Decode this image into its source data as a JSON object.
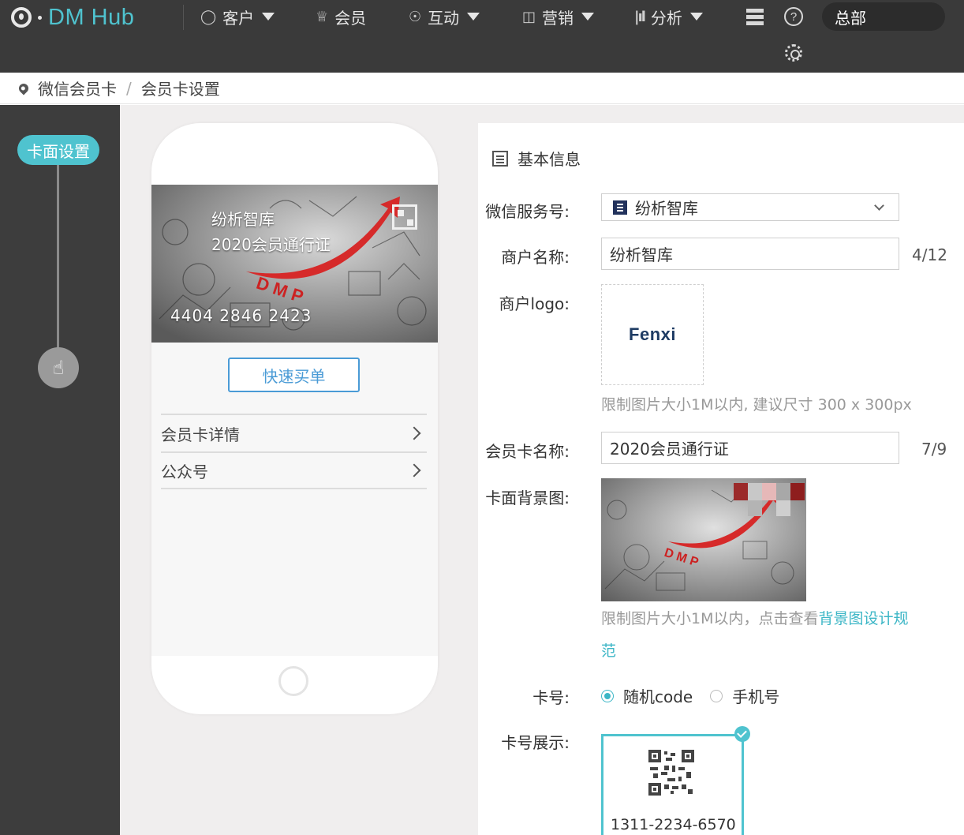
{
  "app": {
    "logo_text": "DM Hub"
  },
  "nav": {
    "items": [
      {
        "label": "客户",
        "icon": "user-icon",
        "has_caret": true
      },
      {
        "label": "会员",
        "icon": "crown-icon",
        "has_caret": false
      },
      {
        "label": "互动",
        "icon": "interaction-icon",
        "has_caret": true
      },
      {
        "label": "营销",
        "icon": "gift-icon",
        "has_caret": true
      },
      {
        "label": "分析",
        "icon": "bar-chart-icon",
        "has_caret": true
      }
    ],
    "org": "总部"
  },
  "breadcrumb": {
    "parent": "微信会员卡",
    "current": "会员卡设置"
  },
  "steps": {
    "active": "卡面设置"
  },
  "preview": {
    "card_brand": "纷析智库",
    "card_name": "2020会员通行证",
    "card_number": "4404 2846 2423",
    "quick_buy": "快速买单",
    "rows": [
      {
        "label": "会员卡详情"
      },
      {
        "label": "公众号"
      }
    ]
  },
  "form": {
    "section_title": "基本信息",
    "service_account": {
      "label": "微信服务号:",
      "value": "纷析智库"
    },
    "merchant_name": {
      "label": "商户名称:",
      "value": "纷析智库",
      "counter": "4/12"
    },
    "merchant_logo": {
      "label": "商户logo:",
      "logo_text": "Fenxi",
      "hint": "限制图片大小1M以内, 建议尺寸 300 x 300px"
    },
    "card_name": {
      "label": "会员卡名称:",
      "value": "2020会员通行证",
      "counter": "7/9"
    },
    "card_bg": {
      "label": "卡面背景图:",
      "hint_prefix": "限制图片大小1M以内，点击查看",
      "hint_link_1": "背景图设计规",
      "hint_link_2": "范"
    },
    "card_number": {
      "label": "卡号:",
      "options": [
        "随机code",
        "手机号"
      ],
      "selected": "随机code"
    },
    "card_display": {
      "label": "卡号展示:",
      "sample_number": "1311-2234-6570"
    }
  },
  "colors": {
    "accent": "#4fc3cf",
    "topbar": "#3a3a3a",
    "link": "#3cb6c6"
  }
}
